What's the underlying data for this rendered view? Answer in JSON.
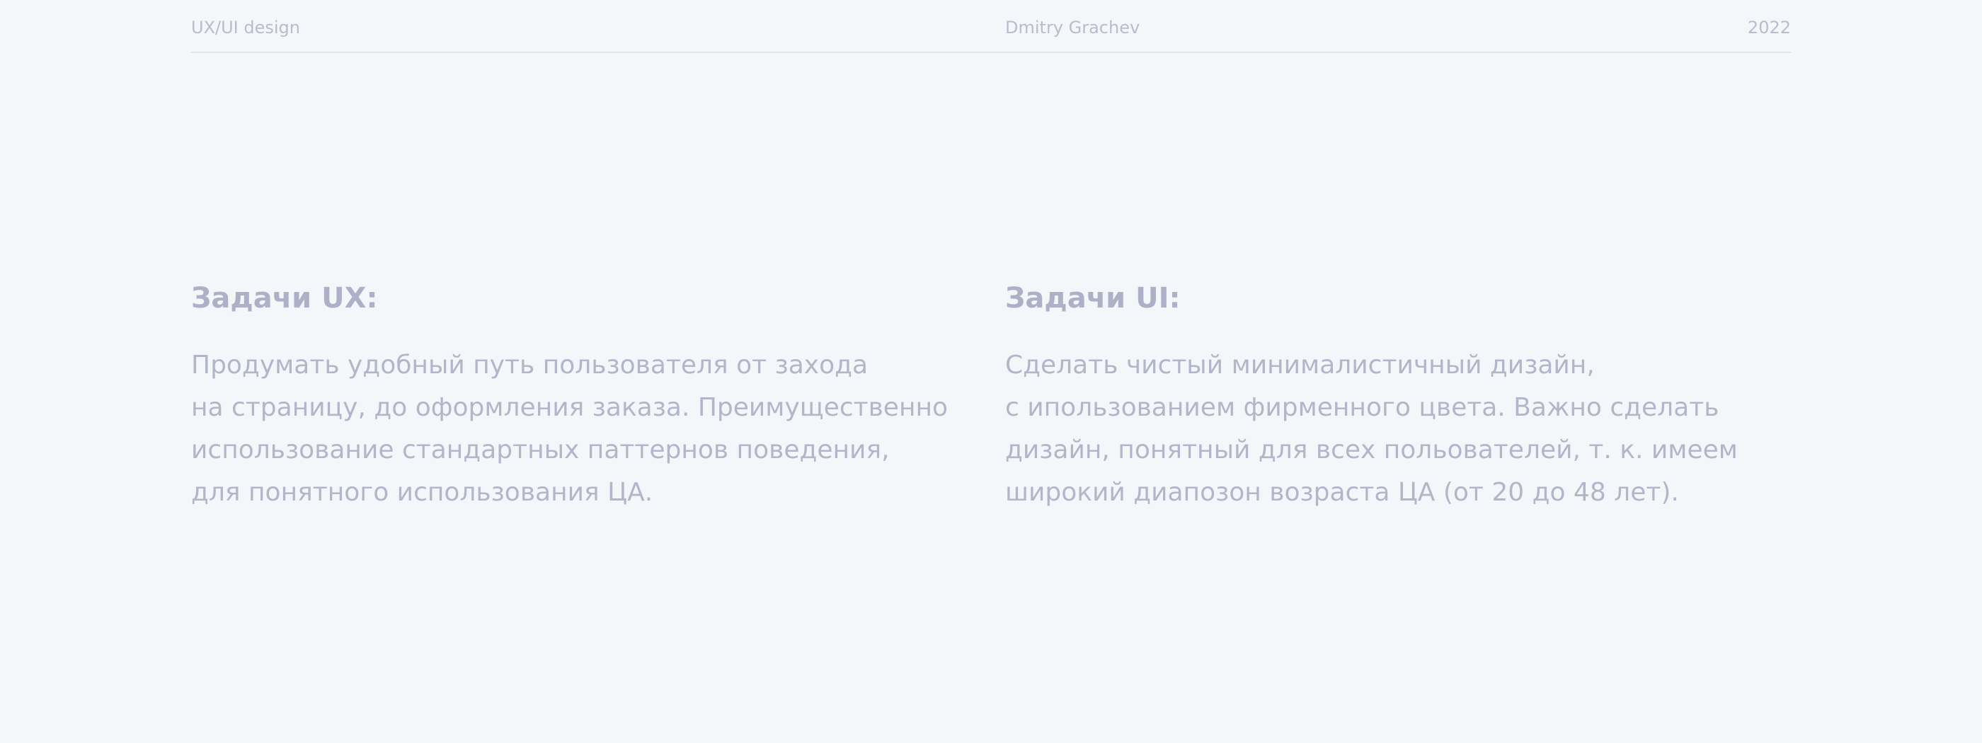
{
  "header": {
    "left": "UX/UI design",
    "center": "Dmitry Grachev",
    "right": "2022"
  },
  "ux": {
    "title": "Задачи UX:",
    "lines": [
      "Продумать удобный путь пользователя от захода",
      "на страницу, до оформления заказа. Преимущественно",
      "использование стандартных паттернов поведения,",
      "для понятного использования ЦА."
    ]
  },
  "ui": {
    "title": "Задачи UI:",
    "lines": [
      "Сделать чистый минималистичный дизайн,",
      "с ипользованием фирменного цвета. Важно сделать",
      "дизайн, понятный для всех польователей, т. к. имеем",
      "широкий диапозон возраста ЦА (от 20 до 48 лет)."
    ]
  }
}
